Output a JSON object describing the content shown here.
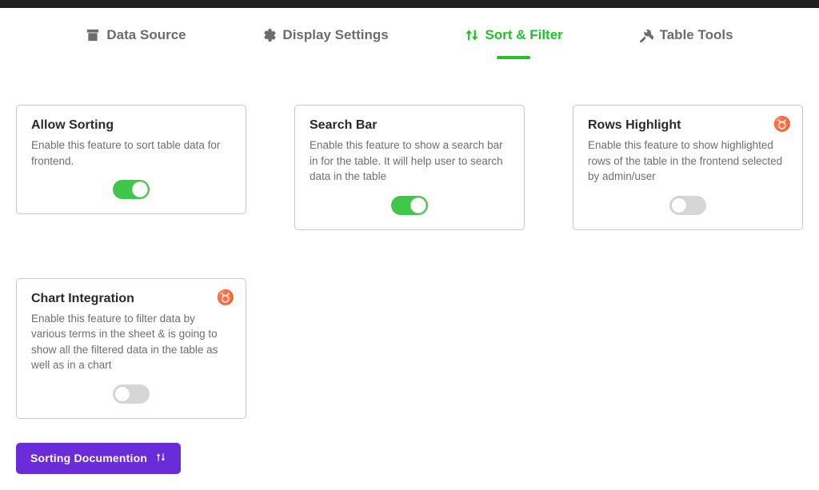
{
  "colors": {
    "accent_green": "#22c12b",
    "accent_purple": "#6a2bd9",
    "badge_purple": "#5b21c9"
  },
  "tabs": [
    {
      "label": "Data Source",
      "icon": "archive-icon",
      "active": false
    },
    {
      "label": "Display Settings",
      "icon": "settings-icon",
      "active": false
    },
    {
      "label": "Sort & Filter",
      "icon": "sort-icon",
      "active": true
    },
    {
      "label": "Table Tools",
      "icon": "tools-icon",
      "active": false
    }
  ],
  "cards": [
    {
      "title": "Allow Sorting",
      "desc": "Enable this feature to sort table data for frontend.",
      "toggle_on": true,
      "pro": false
    },
    {
      "title": "Search Bar",
      "desc": "Enable this feature to show a search bar in for the table. It will help user to search data in the table",
      "toggle_on": true,
      "pro": false
    },
    {
      "title": "Rows Highlight",
      "desc": "Enable this feature to show highlighted rows of the table in the frontend selected by admin/user",
      "toggle_on": false,
      "pro": true
    },
    {
      "title": "Chart Integration",
      "desc": "Enable this feature to filter data by various terms in the sheet & is going to show all the filtered data in the table as well as in a chart",
      "toggle_on": false,
      "pro": true
    }
  ],
  "doc_button_label": "Sorting Documention"
}
